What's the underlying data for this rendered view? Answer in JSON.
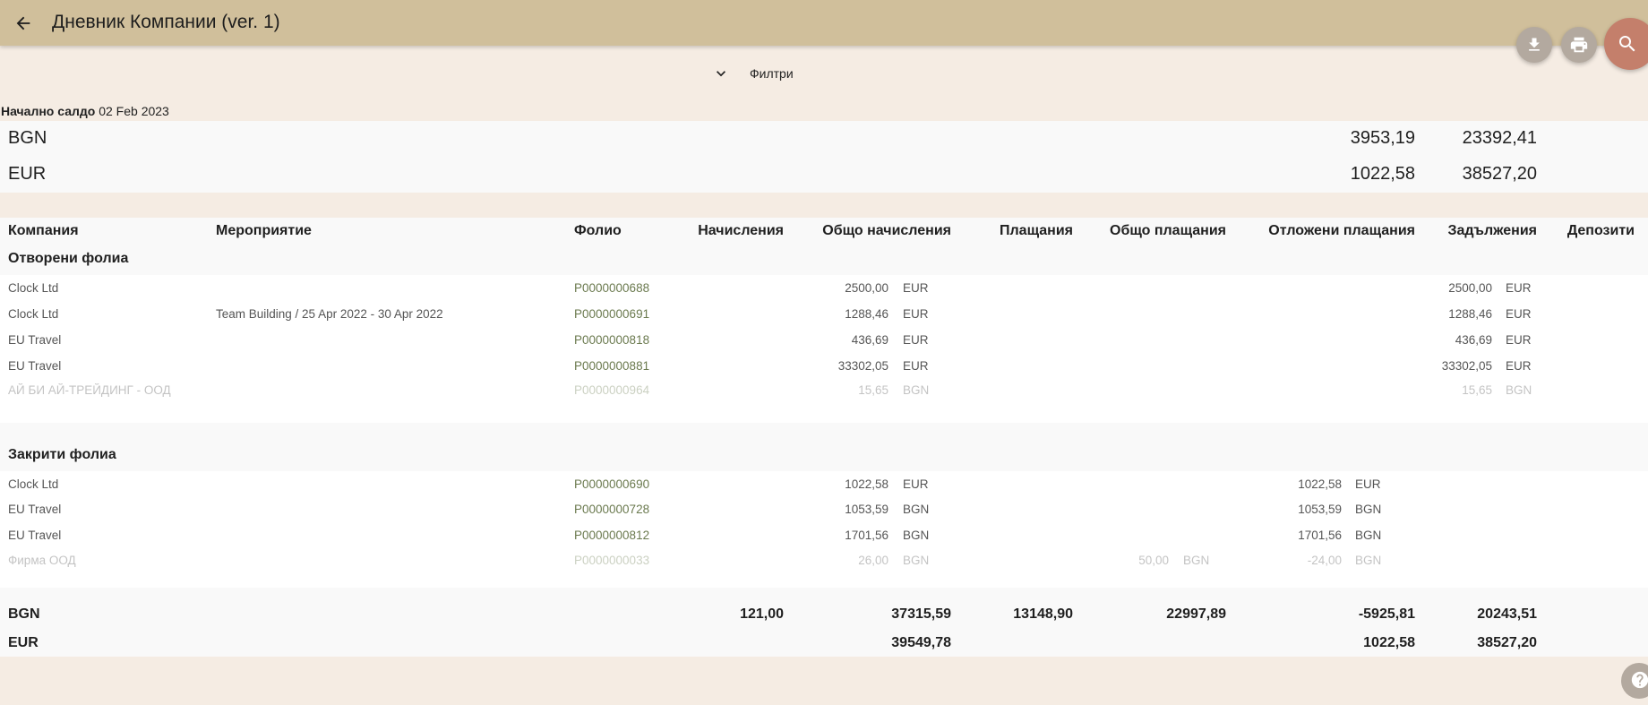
{
  "header": {
    "title": "Дневник Компании (ver. 1)",
    "back_icon": "arrow-back-icon",
    "actions": [
      {
        "name": "download",
        "icon": "download-icon"
      },
      {
        "name": "print",
        "icon": "print-icon"
      },
      {
        "name": "search",
        "icon": "search-icon"
      }
    ]
  },
  "filters": {
    "label": "Филтри",
    "icon": "chevron-down-icon"
  },
  "opening": {
    "label": "Начално салдо",
    "date": "02 Feb 2023"
  },
  "balances": [
    {
      "currency": "BGN",
      "a": "3953,19",
      "b": "23392,41"
    },
    {
      "currency": "EUR",
      "a": "1022,58",
      "b": "38527,20"
    }
  ],
  "table": {
    "headers": {
      "company": "Компания",
      "event": "Мероприятие",
      "folio": "Фолио",
      "charges": "Начисления",
      "total_charges": "Общо начисления",
      "payments": "Плащания",
      "total_payments": "Общо плащания",
      "deferred_payments": "Отложени плащания",
      "debts": "Задължения",
      "deposits": "Депозити"
    },
    "open_section": {
      "title": "Отворени фолиа",
      "rows": [
        {
          "company": "Clock Ltd",
          "event": "",
          "folio": "P0000000688",
          "total_charges": "2500,00",
          "tc_cur": "EUR",
          "debts": "2500,00",
          "d_cur": "EUR"
        },
        {
          "company": "Clock Ltd",
          "event": "Team Building / 25 Apr 2022 - 30 Apr 2022",
          "folio": "P0000000691",
          "total_charges": "1288,46",
          "tc_cur": "EUR",
          "debts": "1288,46",
          "d_cur": "EUR"
        },
        {
          "company": "EU Travel",
          "event": "",
          "folio": "P0000000818",
          "total_charges": "436,69",
          "tc_cur": "EUR",
          "debts": "436,69",
          "d_cur": "EUR"
        },
        {
          "company": "EU Travel",
          "event": "",
          "folio": "P0000000881",
          "total_charges": "33302,05",
          "tc_cur": "EUR",
          "debts": "33302,05",
          "d_cur": "EUR"
        },
        {
          "company": "АЙ БИ АЙ-ТРЕЙДИНГ - ООД",
          "event": "",
          "folio": "P0000000964",
          "total_charges": "15,65",
          "tc_cur": "BGN",
          "debts": "15,65",
          "d_cur": "BGN"
        }
      ]
    },
    "closed_section": {
      "title": "Закрити фолиа",
      "rows": [
        {
          "company": "Clock Ltd",
          "folio": "P0000000690",
          "total_charges": "1022,58",
          "tc_cur": "EUR",
          "total_payments": "",
          "tp_cur": "",
          "deferred": "1022,58",
          "df_cur": "EUR"
        },
        {
          "company": "EU Travel",
          "folio": "P0000000728",
          "total_charges": "1053,59",
          "tc_cur": "BGN",
          "total_payments": "",
          "tp_cur": "",
          "deferred": "1053,59",
          "df_cur": "BGN"
        },
        {
          "company": "EU Travel",
          "folio": "P0000000812",
          "total_charges": "1701,56",
          "tc_cur": "BGN",
          "total_payments": "",
          "tp_cur": "",
          "deferred": "1701,56",
          "df_cur": "BGN"
        },
        {
          "company": "Фирма ООД",
          "folio": "P0000000033",
          "total_charges": "26,00",
          "tc_cur": "BGN",
          "total_payments": "50,00",
          "tp_cur": "BGN",
          "deferred": "-24,00",
          "df_cur": "BGN"
        }
      ]
    },
    "totals": [
      {
        "currency": "BGN",
        "charges": "121,00",
        "total_charges": "37315,59",
        "payments": "13148,90",
        "total_payments": "22997,89",
        "deferred": "-5925,81",
        "debts": "20243,51"
      },
      {
        "currency": "EUR",
        "charges": "",
        "total_charges": "39549,78",
        "payments": "",
        "total_payments": "",
        "deferred": "1022,58",
        "debts": "38527,20"
      }
    ]
  },
  "help": {
    "icon": "help-icon"
  }
}
